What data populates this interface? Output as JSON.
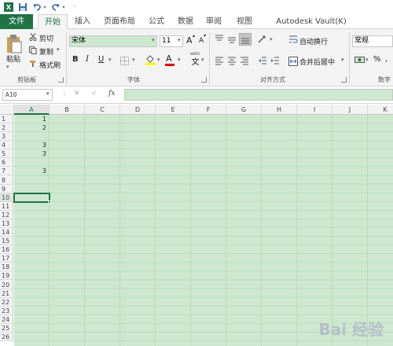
{
  "app": {
    "name": "Excel",
    "logo_letter": "X"
  },
  "quick_access": [
    "save-icon",
    "undo-icon",
    "redo-icon",
    "customize-icon"
  ],
  "tabs": [
    {
      "label": "文件"
    },
    {
      "label": "开始"
    },
    {
      "label": "插入"
    },
    {
      "label": "页面布局"
    },
    {
      "label": "公式"
    },
    {
      "label": "数据"
    },
    {
      "label": "审阅"
    },
    {
      "label": "视图"
    },
    {
      "label": "Autodesk Vault(K)"
    }
  ],
  "ribbon": {
    "clipboard": {
      "paste": "粘贴",
      "cut": "剪切",
      "copy": "复制",
      "format_painter": "格式刷",
      "label": "剪贴板"
    },
    "font": {
      "name": "宋体",
      "size": "11",
      "grow": "A",
      "shrink": "A",
      "bold": "B",
      "italic": "I",
      "underline": "U",
      "font_color_letter": "A",
      "phonetic": "wén",
      "label": "字体"
    },
    "alignment": {
      "wrap_text": "自动换行",
      "merge_center": "合并后居中",
      "label": "对齐方式"
    },
    "number": {
      "format": "常规",
      "percent": "%",
      "label": "数字"
    }
  },
  "formula_bar": {
    "name_box": "A10",
    "fx": "fx",
    "content": ""
  },
  "sheet": {
    "columns": [
      "A",
      "B",
      "C",
      "D",
      "E",
      "F",
      "G",
      "H",
      "I",
      "J",
      "K"
    ],
    "selected_column": "A",
    "rows": [
      1,
      2,
      3,
      4,
      5,
      6,
      7,
      8,
      9,
      10,
      11,
      12,
      13,
      14,
      15,
      16,
      17,
      18,
      19,
      20,
      21,
      22,
      23,
      24,
      25,
      26
    ],
    "selected_row": 10,
    "selected_cell": "A10",
    "cells": [
      {
        "ref": "A1",
        "value": "1"
      },
      {
        "ref": "A2",
        "value": "2"
      },
      {
        "ref": "A4",
        "value": "3"
      },
      {
        "ref": "A5",
        "value": "3"
      },
      {
        "ref": "A7",
        "value": "3"
      }
    ]
  },
  "watermark": "Bai 经验"
}
